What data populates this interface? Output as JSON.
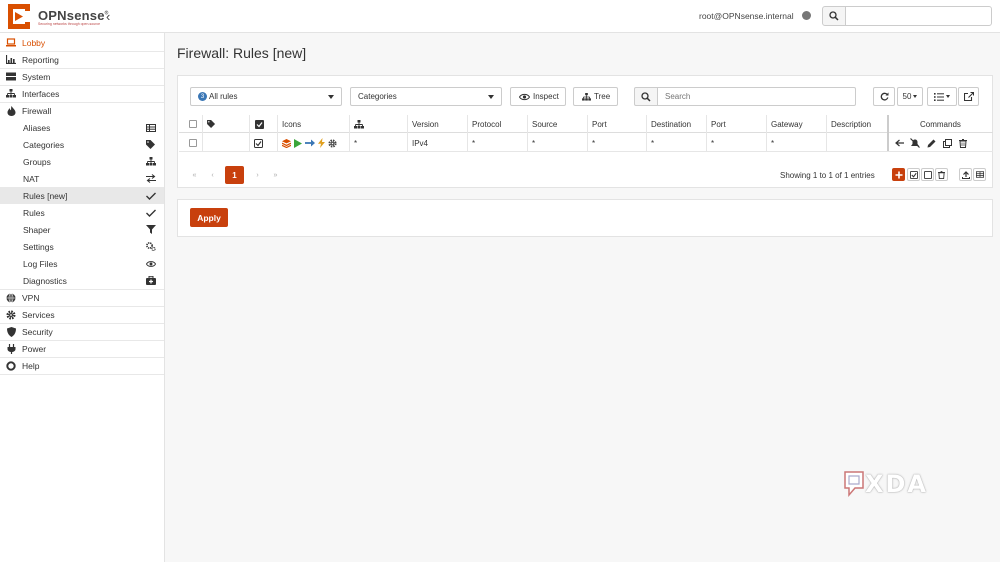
{
  "app": {
    "brand": "OPNsense",
    "reg_mark": "®",
    "tagline": "Securing networks through open-source",
    "user": "root@OPNsense.internal",
    "accent": "#c8400d"
  },
  "sidebar": {
    "lobby": "Lobby",
    "reporting": "Reporting",
    "system": "System",
    "interfaces": "Interfaces",
    "firewall": "Firewall",
    "firewall_items": [
      {
        "label": "Aliases",
        "icon": "table-icon"
      },
      {
        "label": "Categories",
        "icon": "tags-icon"
      },
      {
        "label": "Groups",
        "icon": "sitemap-icon"
      },
      {
        "label": "NAT",
        "icon": "exchange-icon"
      },
      {
        "label": "Rules [new]",
        "icon": "check-icon"
      },
      {
        "label": "Rules",
        "icon": "check-icon"
      },
      {
        "label": "Shaper",
        "icon": "filter-icon"
      },
      {
        "label": "Settings",
        "icon": "cogs-icon"
      },
      {
        "label": "Log Files",
        "icon": "eye-icon"
      },
      {
        "label": "Diagnostics",
        "icon": "medkit-icon"
      }
    ],
    "vpn": "VPN",
    "services": "Services",
    "security": "Security",
    "power": "Power",
    "help": "Help"
  },
  "page": {
    "title": "Firewall: Rules [new]"
  },
  "toolbar": {
    "rules_badge": "3",
    "rules_select": "All rules",
    "categories_select": "Categories",
    "inspect_label": "Inspect",
    "tree_label": "Tree",
    "search_placeholder": "Search",
    "page_size": "50"
  },
  "table": {
    "headers": {
      "icons": "Icons",
      "version": "Version",
      "protocol": "Protocol",
      "source": "Source",
      "source_port": "Port",
      "destination": "Destination",
      "destination_port": "Port",
      "gateway": "Gateway",
      "description": "Description",
      "commands": "Commands"
    },
    "rows": [
      {
        "interface": "*",
        "version": "IPv4",
        "protocol": "*",
        "source": "*",
        "source_port": "*",
        "destination": "*",
        "destination_port": "*",
        "gateway": "*",
        "description": ""
      }
    ]
  },
  "pagination": {
    "first": "«",
    "prev": "‹",
    "current": "1",
    "next": "›",
    "last": "»",
    "info": "Showing 1 to 1 of 1 entries"
  },
  "actions": {
    "apply": "Apply"
  },
  "watermark": {
    "text": "XDA"
  }
}
